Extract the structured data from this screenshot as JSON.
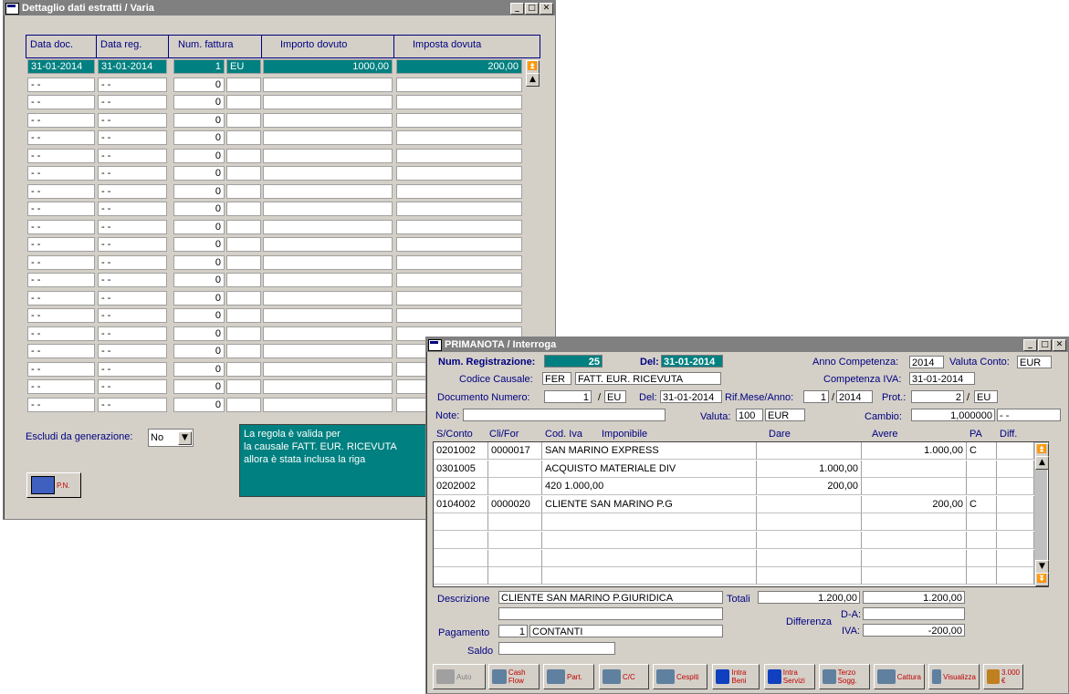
{
  "win1": {
    "title": "Dettaglio dati estratti / Varia",
    "columns": [
      "Data doc.",
      "Data reg.",
      "Num. fattura",
      "Importo dovuto",
      "Imposta dovuta"
    ],
    "first_row": {
      "data_doc": "31-01-2014",
      "data_reg": "31-01-2014",
      "num": "1",
      "ser": "EU",
      "importo": "1000,00",
      "imposta": "200,00"
    },
    "empty_row": {
      "data_doc": "- -",
      "data_reg": "- -",
      "num": "0"
    },
    "escludi_label": "Escludi da generazione:",
    "escludi_value": "No",
    "info_text": [
      "La regola è valida per",
      "la causale FATT. EUR. RICEVUTA",
      "allora è stata inclusa la riga"
    ],
    "pn_label": "P.N."
  },
  "win2": {
    "title": "PRIMANOTA / Interroga",
    "num_reg_label": "Num. Registrazione:",
    "num_reg": "25",
    "del_label": "Del:",
    "del_value": "31-01-2014",
    "anno_comp_label": "Anno Competenza:",
    "anno_comp": "2014",
    "valuta_conto_label": "Valuta Conto:",
    "valuta_conto": "EUR",
    "codice_causale_label": "Codice Causale:",
    "codice_causale": "FER",
    "causale_desc": "FATT. EUR. RICEVUTA",
    "competenza_iva_label": "Competenza IVA:",
    "competenza_iva": "31-01-2014",
    "doc_num_label": "Documento Numero:",
    "doc_num": "1",
    "slash": "/",
    "doc_serie": "EU",
    "doc_del_label": "Del:",
    "doc_del": "31-01-2014",
    "rif_label": "Rif.Mese/Anno:",
    "rif_mese": "1",
    "rif_anno": "2014",
    "prot_label": "Prot.:",
    "prot": "2",
    "prot_serie": "EU",
    "note_label": "Note:",
    "valuta_label": "Valuta:",
    "valuta_code": "100",
    "valuta": "EUR",
    "cambio_label": "Cambio:",
    "cambio": "1,000000",
    "cambio_extra": "- -",
    "grid_headers": [
      "S/Conto",
      "Cli/For",
      "Cod. Iva",
      "Imponibile",
      "Dare",
      "Avere",
      "PA",
      "Diff."
    ],
    "rows": [
      {
        "sconto": "0201002",
        "clifor": "0000017",
        "desc": "SAN MARINO EXPRESS",
        "dare": "",
        "avere": "1.000,00",
        "pa": "C"
      },
      {
        "sconto": "0301005",
        "clifor": "",
        "desc": "ACQUISTO MATERIALE DIV",
        "dare": "1.000,00",
        "avere": "",
        "pa": ""
      },
      {
        "sconto": "0202002",
        "clifor": "",
        "desc": "420       1.000,00",
        "dare": "200,00",
        "avere": "",
        "pa": ""
      },
      {
        "sconto": "0104002",
        "clifor": "0000020",
        "desc": "CLIENTE SAN MARINO P.G",
        "dare": "",
        "avere": "200,00",
        "pa": "C"
      }
    ],
    "descrizione_label": "Descrizione",
    "descrizione": "CLIENTE SAN MARINO P.GIURIDICA",
    "totali_label": "Totali",
    "totale_dare": "1.200,00",
    "totale_avere": "1.200,00",
    "differenza_label": "Differenza",
    "da_label": "D-A:",
    "iva_label": "IVA:",
    "iva_diff": "-200,00",
    "pagamento_label": "Pagamento",
    "pagamento_code": "1",
    "pagamento": "CONTANTI",
    "saldo_label": "Saldo",
    "toolbar": [
      {
        "name": "auto",
        "label": "Auto",
        "color": "#808080"
      },
      {
        "name": "cash-flow",
        "label": "Cash Flow",
        "color": "#c00000"
      },
      {
        "name": "partite",
        "label": "Part.",
        "color": "#c00000"
      },
      {
        "name": "cc",
        "label": "C/C",
        "color": "#c00000"
      },
      {
        "name": "cespiti",
        "label": "Cespiti",
        "color": "#c00000"
      },
      {
        "name": "intra-beni",
        "label": "Intra Beni",
        "color": "#c00000"
      },
      {
        "name": "intra-servizi",
        "label": "Intra Servizi",
        "color": "#c00000"
      },
      {
        "name": "terzo-sogg",
        "label": "Terzo Sogg.",
        "color": "#c00000"
      },
      {
        "name": "cattura",
        "label": "Cattura",
        "color": "#c00000"
      },
      {
        "name": "visualizza",
        "label": "Visualizza",
        "color": "#c00000"
      },
      {
        "name": "euro",
        "label": "3.000 €",
        "color": "#c00000"
      }
    ]
  }
}
